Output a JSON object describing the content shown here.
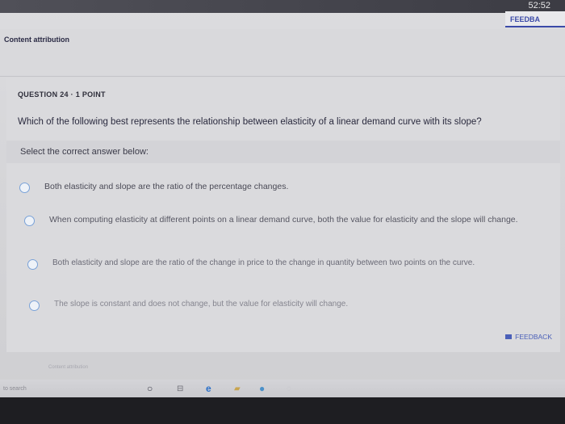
{
  "header": {
    "timer": "52:52",
    "feedback_label": "FEEDBA",
    "content_attribution": "Content attribution"
  },
  "question": {
    "label": "QUESTION 24 · 1 POINT",
    "text": "Which of the following best represents the relationship between elasticity of a linear demand curve with its slope?",
    "instruction": "Select the correct answer below:"
  },
  "options": [
    {
      "text": "Both elasticity and slope are the ratio of the percentage changes."
    },
    {
      "text": "When computing elasticity at different points on a linear demand curve, both the value for elasticity and the slope will change."
    },
    {
      "text": "Both elasticity and slope are the ratio of the change in price to the change in quantity between two points on the curve."
    },
    {
      "text": "The slope is constant and does not change, but the value for elasticity will change."
    }
  ],
  "footer": {
    "feedback_label": "FEEDBACK",
    "content_attribution": "Content attribution"
  },
  "taskbar": {
    "search_text": "to search",
    "icons": [
      "search-circle-icon",
      "task-view-icon",
      "edge-icon",
      "file-explorer-icon",
      "chrome-icon",
      "app-icon"
    ]
  }
}
